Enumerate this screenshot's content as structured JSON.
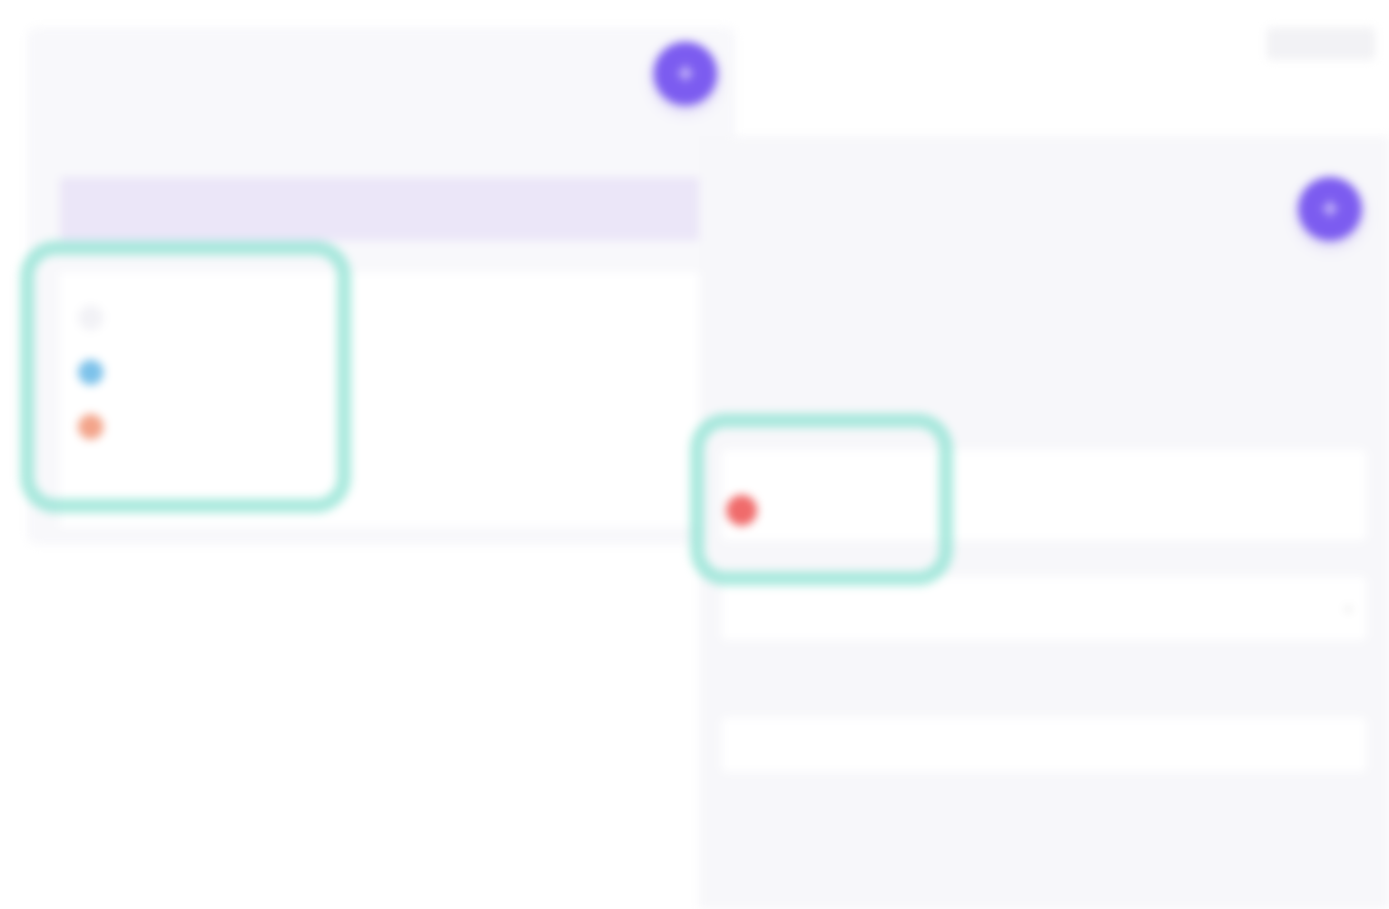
{
  "left": {
    "title": "",
    "fab_icon": "plus-icon",
    "fab_caption": "",
    "tabs": {
      "active_label": ""
    },
    "dropdown": {
      "label": "",
      "items": [
        {
          "icon": "empty-avatar",
          "text": "",
          "style": "link"
        },
        {
          "icon": "blue-avatar",
          "text": "",
          "style": "normal"
        },
        {
          "icon": "orange-avatar",
          "text": "",
          "style": "normal"
        }
      ]
    },
    "footer_link": ""
  },
  "right": {
    "top_button": "",
    "breadcrumb": "",
    "title": "",
    "fab_icon": "plus-icon",
    "fab_caption": "",
    "field1_label": "",
    "field1_value": "",
    "field2_label": "",
    "owner_name": "",
    "owner_sub": "",
    "row_label": "",
    "row_chevron": "chevron-down-icon",
    "section_label": "",
    "section_link": "",
    "toggle_label": "",
    "danger_text": ""
  },
  "colors": {
    "accent": "#7c5cf0",
    "highlight": "#8fe3d3",
    "danger": "#f06b6b",
    "tab_bg": "#ebe6f8"
  }
}
